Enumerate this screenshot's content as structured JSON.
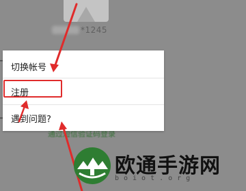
{
  "background": {
    "phone_suffix": "*1245",
    "sms_login_link": "通过短信验证码登录"
  },
  "menu": {
    "items": [
      {
        "label": "切换帐号"
      },
      {
        "label": "注册"
      },
      {
        "label": "遇到问题?"
      }
    ]
  },
  "annotation": {
    "highlight_color": "#e02b2b",
    "arrow_color": "#e02b2b"
  },
  "watermark": {
    "title": "欧通手游网",
    "domain": "boiot.org"
  }
}
